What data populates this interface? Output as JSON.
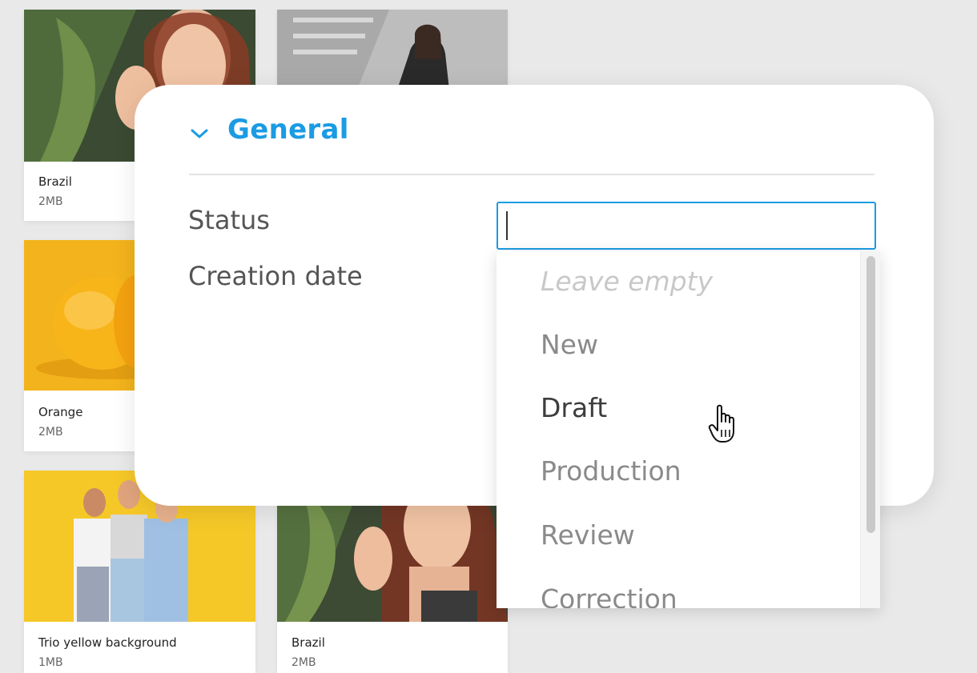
{
  "gallery": {
    "items": [
      {
        "name": "Brazil",
        "size": "2MB"
      },
      {
        "name": "",
        "size": ""
      },
      {
        "name": "Orange",
        "size": "2MB"
      },
      {
        "name": "Trio yellow background",
        "size": "1MB"
      },
      {
        "name": "Brazil",
        "size": "2MB"
      }
    ]
  },
  "panel": {
    "section_title": "General",
    "fields": {
      "status_label": "Status",
      "creation_date_label": "Creation date"
    },
    "status_input": {
      "value": ""
    }
  },
  "dropdown": {
    "options": [
      "Leave empty",
      "New",
      "Draft",
      "Production",
      "Review",
      "Correction"
    ],
    "hovered": "Draft"
  },
  "colors": {
    "accent": "#1b9be3",
    "background": "#e9e9ea"
  },
  "icons": {
    "toggle": "chevron-down-icon",
    "cursor": "hand-pointer-icon"
  }
}
